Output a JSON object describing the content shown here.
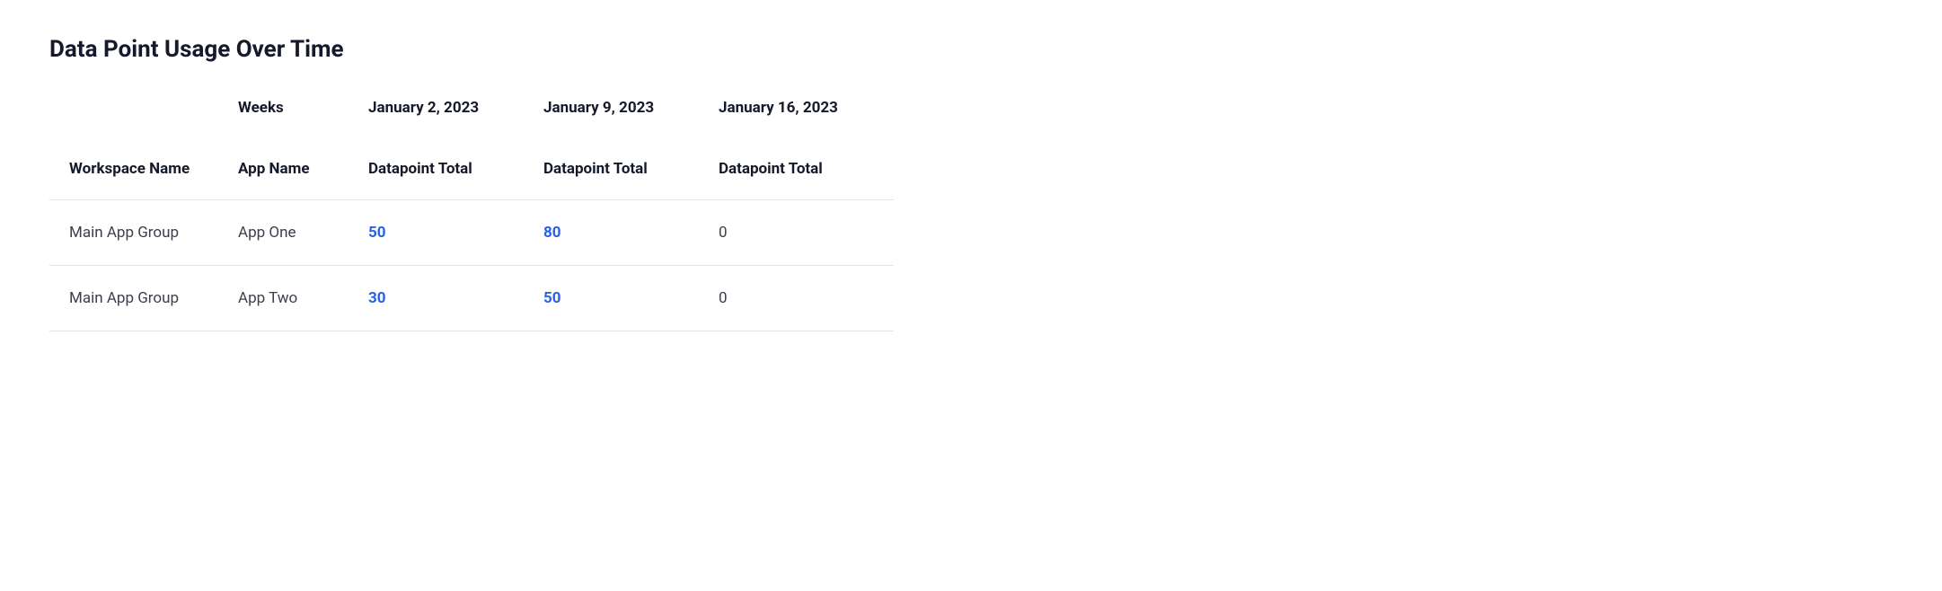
{
  "title": "Data Point Usage Over Time",
  "header_row_1": {
    "col_0": "",
    "col_1": "Weeks",
    "col_2": "January 2, 2023",
    "col_3": "January 9, 2023",
    "col_4": "January 16, 2023"
  },
  "header_row_2": {
    "col_0": "Workspace Name",
    "col_1": "App Name",
    "col_2": "Datapoint Total",
    "col_3": "Datapoint Total",
    "col_4": "Datapoint Total"
  },
  "rows": [
    {
      "workspace": "Main App Group",
      "app": "App One",
      "v0": "50",
      "v1": "80",
      "v2": "0"
    },
    {
      "workspace": "Main App Group",
      "app": "App Two",
      "v0": "30",
      "v1": "50",
      "v2": "0"
    }
  ],
  "chart_data": {
    "type": "table",
    "title": "Data Point Usage Over Time",
    "columns": [
      "Workspace Name",
      "App Name",
      "January 2, 2023",
      "January 9, 2023",
      "January 16, 2023"
    ],
    "rows": [
      [
        "Main App Group",
        "App One",
        50,
        80,
        0
      ],
      [
        "Main App Group",
        "App Two",
        30,
        50,
        0
      ]
    ]
  }
}
